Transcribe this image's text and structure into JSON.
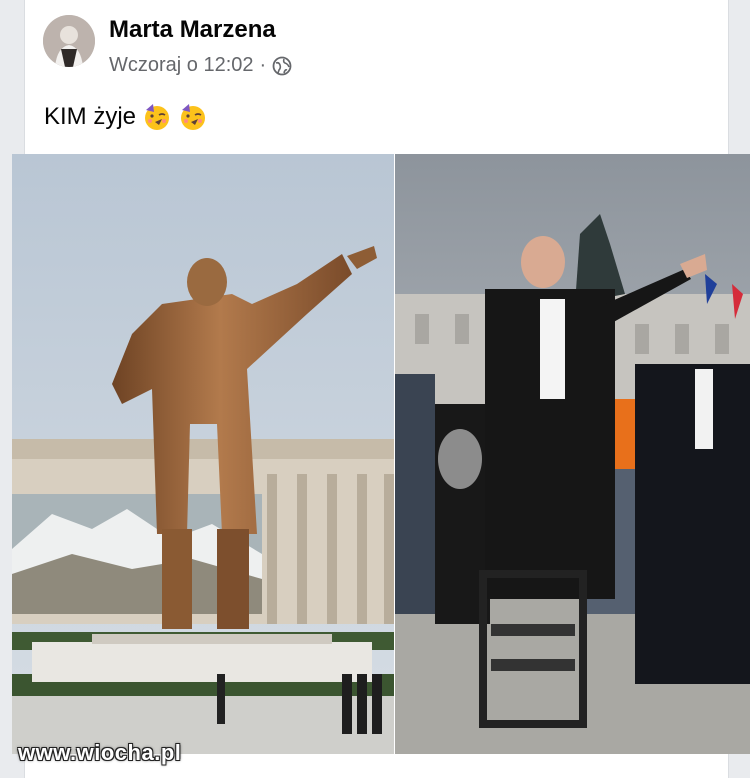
{
  "post": {
    "author_name": "Marta Marzena",
    "timestamp": "Wczoraj o 12:02",
    "separator": "·",
    "privacy_icon": "globe-icon",
    "text": "KIM żyje",
    "emojis": [
      "partying-face-icon",
      "partying-face-icon"
    ]
  },
  "images": {
    "left": "statue-photo",
    "right": "speech-photo"
  },
  "watermark": {
    "text": "www.wiocha.pl"
  },
  "colors": {
    "card_bg": "#ffffff",
    "page_bg": "#e9ebee",
    "name_color": "#050505",
    "meta_color": "#65676b"
  }
}
